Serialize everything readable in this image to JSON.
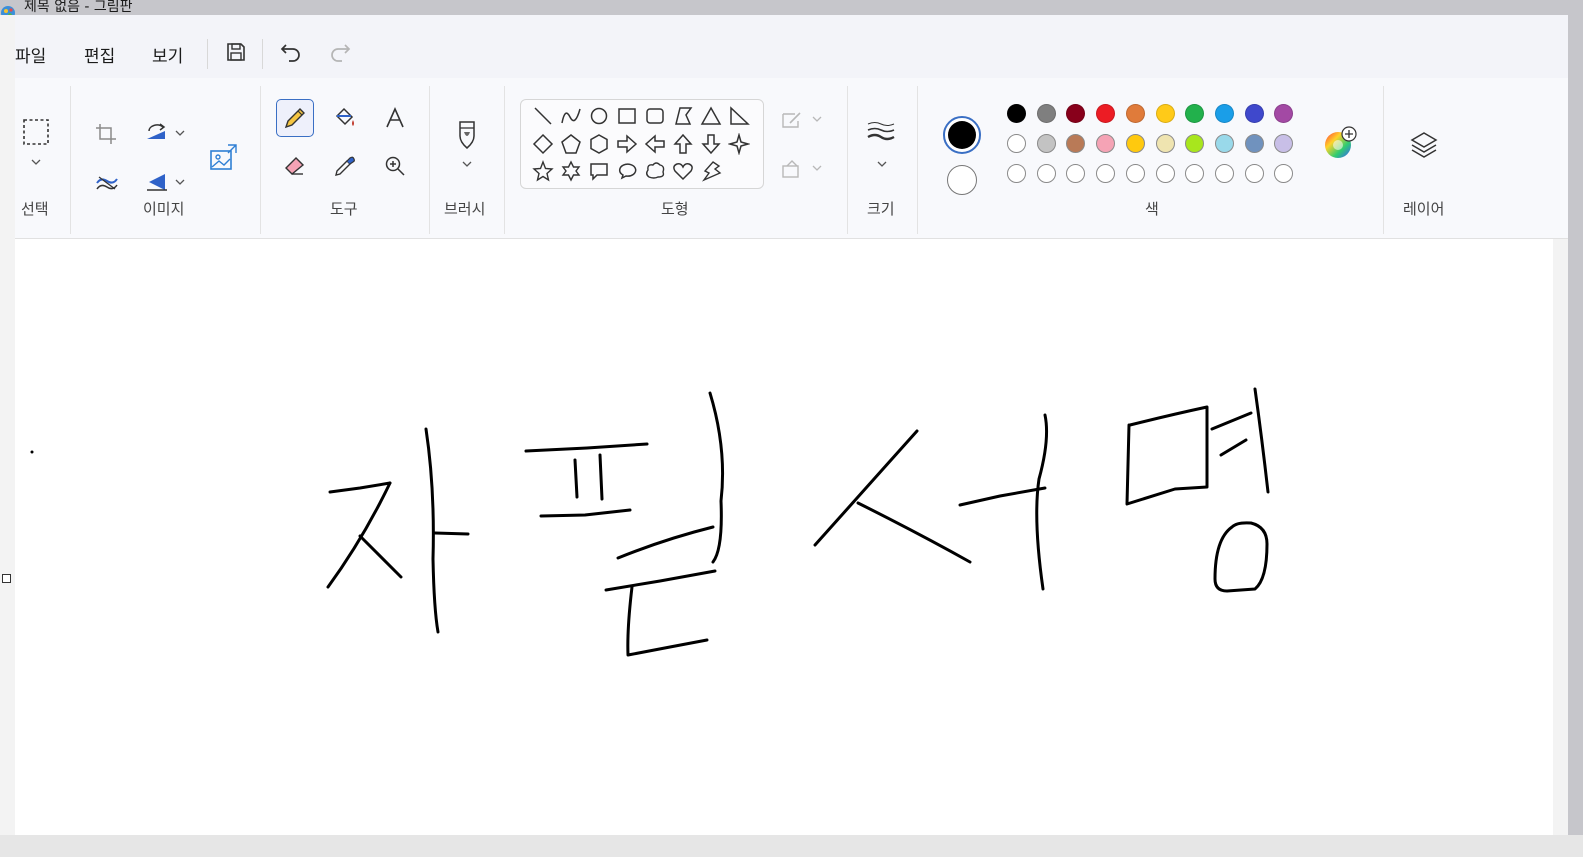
{
  "window": {
    "title": "제목 없음 - 그림판"
  },
  "menu": {
    "file": "파일",
    "edit": "편집",
    "view": "보기",
    "save_icon": "save-icon",
    "undo_icon": "undo-icon",
    "redo_icon": "redo-icon"
  },
  "ribbon": {
    "groups": {
      "select": "선택",
      "image": "이미지",
      "tools": "도구",
      "brush": "브러시",
      "shapes": "도형",
      "size": "크기",
      "color": "색",
      "layers": "레이어"
    },
    "active_tool": "pencil"
  },
  "colors": {
    "primary": "#000000",
    "secondary": "#ffffff",
    "accent": "#3a6fc4",
    "palette_row1": [
      "#000000",
      "#7f7f7f",
      "#88001b",
      "#ec1c24",
      "#e07b3a",
      "#ffca18",
      "#22b14c",
      "#1a9ee8",
      "#3f48cc",
      "#a349a4"
    ],
    "palette_row2": [
      "#ffffff",
      "#c3c3c3",
      "#b97a57",
      "#f5a3b5",
      "#ffc90e",
      "#efe4b0",
      "#a8e61d",
      "#99d9ea",
      "#7092be",
      "#c8bfe7"
    ],
    "palette_row3": [
      "#ffffff",
      "#ffffff",
      "#ffffff",
      "#ffffff",
      "#ffffff",
      "#ffffff",
      "#ffffff",
      "#ffffff",
      "#ffffff",
      "#ffffff"
    ]
  },
  "canvas": {
    "drawing": "handwritten-signature"
  }
}
